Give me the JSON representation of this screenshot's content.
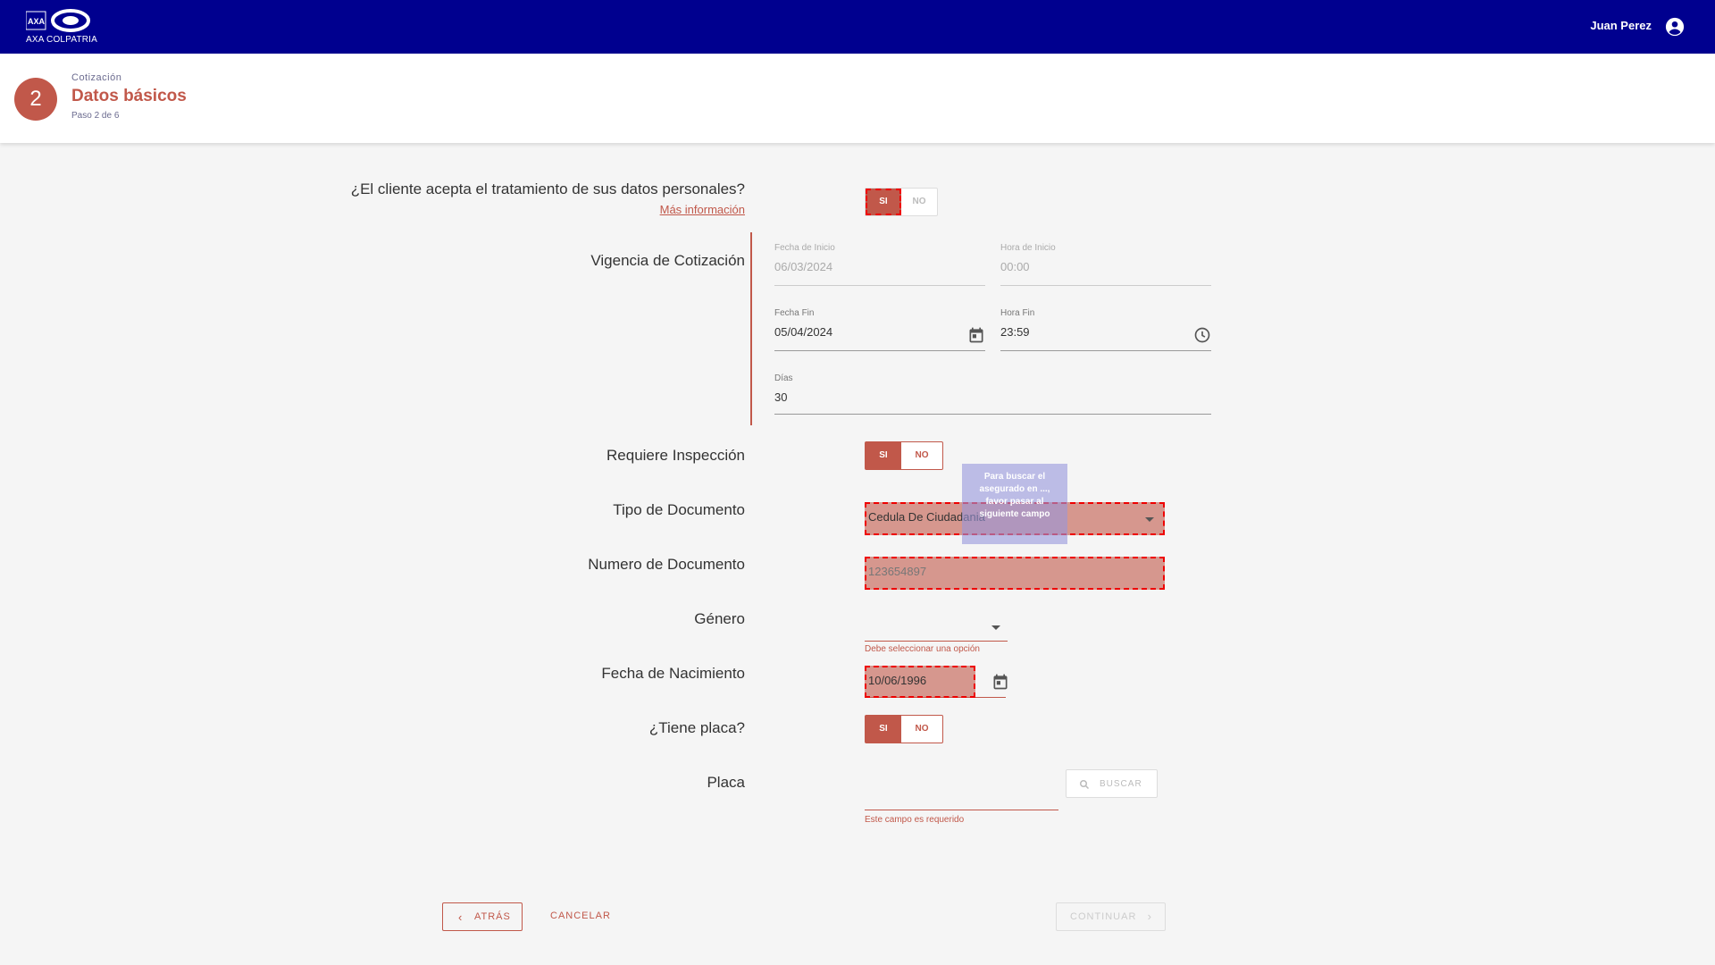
{
  "topbar": {
    "brand": "AXA COLPATRIA",
    "user_name": "Juan Perez",
    "background": "#00008f"
  },
  "header": {
    "step_number": "2",
    "breadcrumb": "Cotización",
    "title": "Datos básicos",
    "step_text": "Paso 2 de 6"
  },
  "consent": {
    "question": "¿El cliente acepta el tratamiento de sus datos personales?",
    "more_info": "Más información",
    "yes": "SI",
    "no": "NO"
  },
  "vigencia": {
    "label": "Vigencia de Cotización",
    "fecha_inicio_label": "Fecha de Inicio",
    "fecha_inicio_value": "06/03/2024",
    "hora_inicio_label": "Hora de Inicio",
    "hora_inicio_value": "00:00",
    "fecha_fin_label": "Fecha Fin",
    "fecha_fin_value": "05/04/2024",
    "hora_fin_label": "Hora Fin",
    "hora_fin_value": "23:59",
    "dias_label": "Días",
    "dias_value": "30"
  },
  "inspeccion": {
    "label": "Requiere Inspección",
    "yes": "SI",
    "no": "NO"
  },
  "tipo_documento": {
    "label": "Tipo de Documento",
    "value": "Cedula De Ciudadania"
  },
  "tooltip": {
    "text": "Para buscar el asegurado en ..., favor pasar al siguiente campo"
  },
  "numero_documento": {
    "label": "Numero de Documento",
    "value": "123654897"
  },
  "genero": {
    "label": "Género",
    "value": "",
    "error": "Debe seleccionar una opción"
  },
  "nacimiento": {
    "label": "Fecha de Nacimiento",
    "value": "10/06/1996"
  },
  "placa_toggle": {
    "label": "¿Tiene placa?",
    "yes": "SI",
    "no": "NO"
  },
  "placa": {
    "label": "Placa",
    "value": "",
    "error": "Este campo es requerido",
    "search_label": "BUSCAR"
  },
  "footer": {
    "back": "ATRÁS",
    "cancel": "CANCELAR",
    "continue": "CONTINUAR"
  },
  "colors": {
    "accent": "#c1584a",
    "highlight": "rgba(193,88,74,0.6)"
  }
}
